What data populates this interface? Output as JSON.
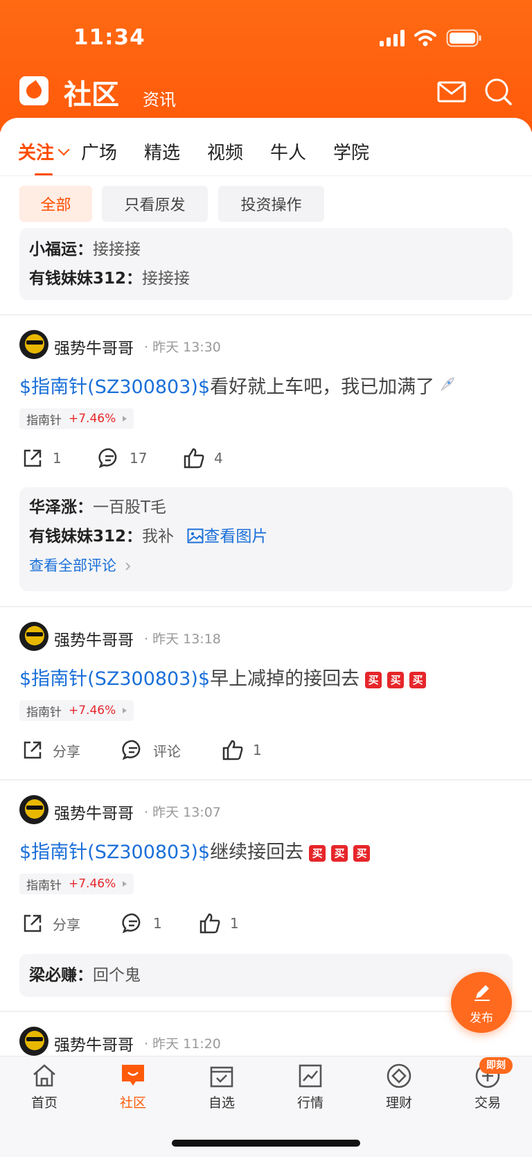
{
  "status_bar": {
    "time": "11:34"
  },
  "header": {
    "title": "社区",
    "subtitle": "资讯",
    "mail_icon": "mail-icon",
    "search_icon": "search-icon"
  },
  "tabs": [
    {
      "label": "关注",
      "active": true
    },
    {
      "label": "广场"
    },
    {
      "label": "精选"
    },
    {
      "label": "视频"
    },
    {
      "label": "牛人"
    },
    {
      "label": "学院"
    }
  ],
  "filters": [
    {
      "label": "全部",
      "active": true
    },
    {
      "label": "只看原发"
    },
    {
      "label": "投资操作"
    }
  ],
  "top_comments": [
    {
      "user": "小福运：",
      "text": "接接接"
    },
    {
      "user": "有钱妹妹312：",
      "text": "接接接"
    }
  ],
  "posts": [
    {
      "author": "强势牛哥哥",
      "time": "· 昨天 13:30",
      "stock": "$指南针(SZ300803)$",
      "text": "看好就上车吧，我已加满了",
      "tag_name": "指南针",
      "tag_change": "+7.46%",
      "share": "1",
      "comment": "17",
      "like": "4",
      "comments": [
        {
          "user": "华泽涨：",
          "text": "一百股T毛"
        },
        {
          "user": "有钱妹妹312：",
          "text": "我补",
          "link": "查看图片"
        }
      ],
      "see_all": "查看全部评论"
    },
    {
      "author": "强势牛哥哥",
      "time": "· 昨天 13:18",
      "stock": "$指南针(SZ300803)$",
      "text": "早上减掉的接回去",
      "emoji": [
        "买",
        "买",
        "买"
      ],
      "tag_name": "指南针",
      "tag_change": "+7.46%",
      "share": "分享",
      "comment": "评论",
      "like": "1"
    },
    {
      "author": "强势牛哥哥",
      "time": "· 昨天 13:07",
      "stock": "$指南针(SZ300803)$",
      "text": "继续接回去",
      "emoji": [
        "买",
        "买",
        "买"
      ],
      "tag_name": "指南针",
      "tag_change": "+7.46%",
      "share": "分享",
      "comment": "1",
      "like": "1",
      "comments": [
        {
          "user": "梁必赚：",
          "text": "回个鬼"
        }
      ]
    },
    {
      "author": "强势牛哥哥",
      "time": "· 昨天 11:20"
    }
  ],
  "fab": {
    "label": "发布"
  },
  "bottom_nav": [
    {
      "label": "首页",
      "icon": "home-icon"
    },
    {
      "label": "社区",
      "icon": "community-icon",
      "active": true
    },
    {
      "label": "自选",
      "icon": "watchlist-icon"
    },
    {
      "label": "行情",
      "icon": "market-icon"
    },
    {
      "label": "理财",
      "icon": "wealth-icon"
    },
    {
      "label": "交易",
      "icon": "trade-icon",
      "badge": "即刻"
    }
  ],
  "colors": {
    "brand": "#ff5a0a",
    "link": "#1a6fd8",
    "up": "#e6262a"
  }
}
